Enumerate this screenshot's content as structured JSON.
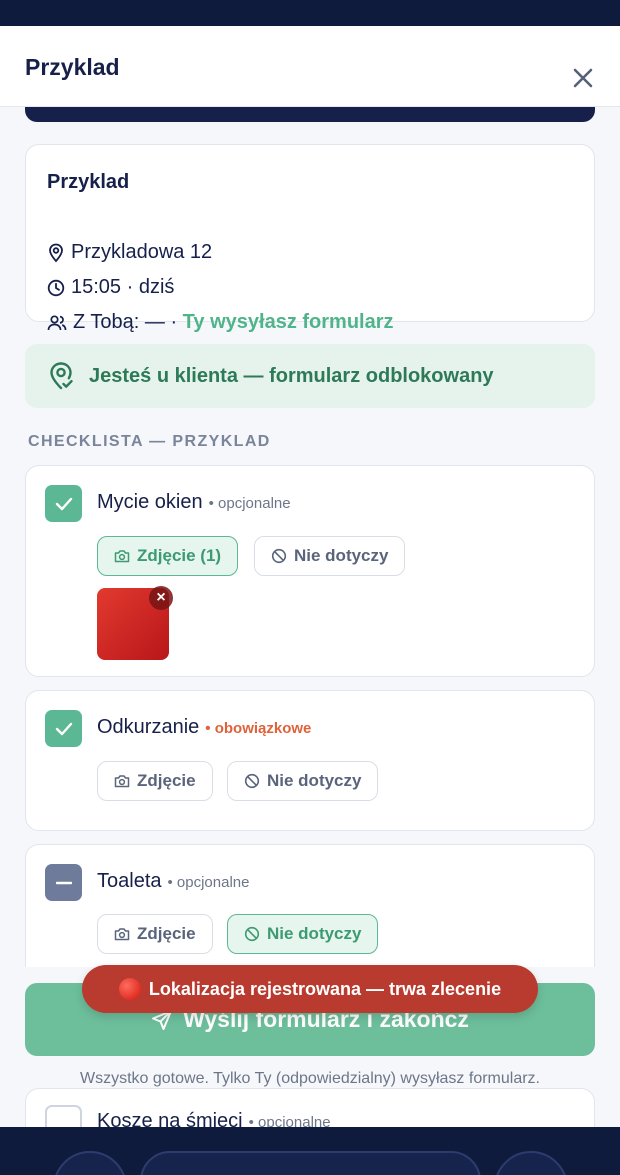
{
  "header": {
    "title": "Przyklad",
    "close_icon": "close-icon"
  },
  "client": {
    "name": "Przyklad",
    "address": "Przykladowa 12",
    "time": "15:05 · dziś",
    "with_you": "Z Tobą: — · ",
    "sender_note": "Ty wysyłasz formularz"
  },
  "banner": {
    "icon": "location-check-icon",
    "text": "Jesteś u klienta — formularz odblokowany"
  },
  "checklist": {
    "section_label": "CHECKLISTA — PRZYKLAD",
    "items": [
      {
        "title": "Mycie okien",
        "tag": "• opcjonalne",
        "state": "checked",
        "photo_label": "Zdjęcie (1)",
        "na_label": "Nie dotyczy",
        "thumb_remove": "×"
      },
      {
        "title": "Odkurzanie",
        "tag": "• obowiązkowe",
        "state": "checked",
        "photo_label": "Zdjęcie",
        "na_label": "Nie dotyczy"
      },
      {
        "title": "Toaleta",
        "tag": "• opcjonalne",
        "state": "not-applicable",
        "photo_label": "Zdjęcie",
        "na_label": "Nie dotyczy"
      },
      {
        "title": "Kosze na śmieci",
        "tag": "• opcjonalne",
        "state": "unchecked"
      }
    ]
  },
  "toast": {
    "text": "Lokalizacja rejestrowana — trwa zlecenie"
  },
  "send_button": {
    "label": "Wyślij formularz i zakończ",
    "icon": "send-icon"
  },
  "footer_note": "Wszystko gotowe. Tylko Ty (odpowiedzialny) wysyłasz formularz.",
  "colors": {
    "navy": "#0f1b3d",
    "green": "#5cb894",
    "red_toast": "#b93a2e",
    "required": "#e0623a"
  }
}
